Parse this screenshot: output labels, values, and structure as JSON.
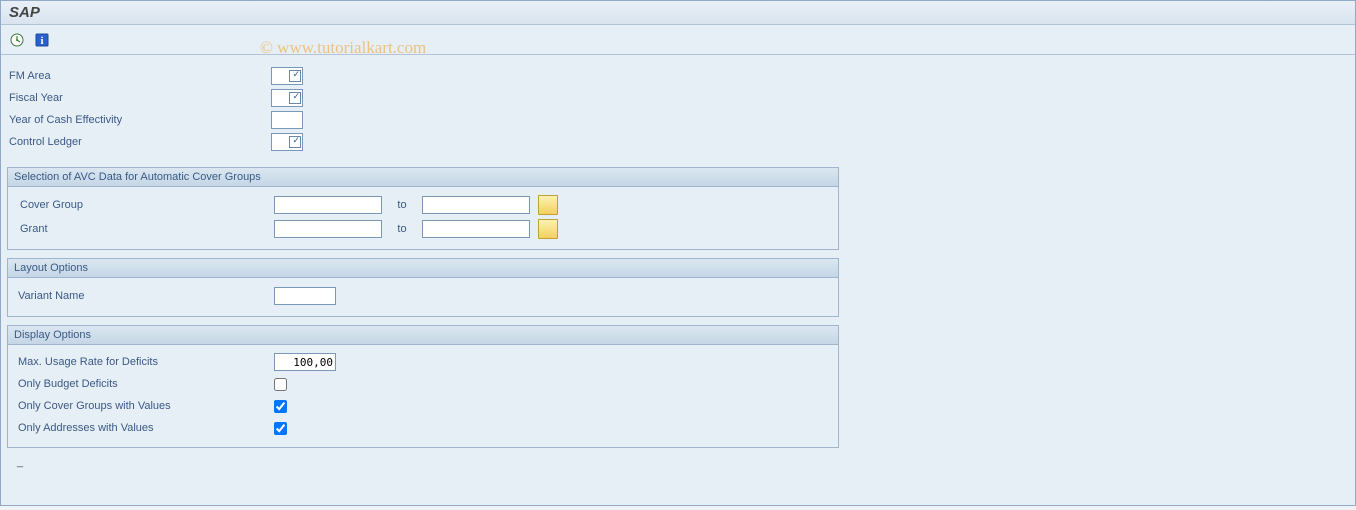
{
  "window": {
    "title": "SAP"
  },
  "watermark": "© www.tutorialkart.com",
  "topFields": {
    "fmArea": {
      "label": "FM Area",
      "value": "",
      "required": true
    },
    "fiscalYear": {
      "label": "Fiscal Year",
      "value": "",
      "required": true
    },
    "yearCash": {
      "label": "Year of Cash Effectivity",
      "value": "",
      "required": false
    },
    "controlLedger": {
      "label": "Control Ledger",
      "value": "",
      "required": true
    }
  },
  "sectionAVC": {
    "title": "Selection of AVC Data for Automatic Cover Groups",
    "coverGroup": {
      "label": "Cover Group",
      "from": "",
      "to_label": "to",
      "to": ""
    },
    "grant": {
      "label": "Grant",
      "from": "",
      "to_label": "to",
      "to": ""
    }
  },
  "sectionLayout": {
    "title": "Layout Options",
    "variantName": {
      "label": "Variant Name",
      "value": ""
    }
  },
  "sectionDisplay": {
    "title": "Display Options",
    "maxUsage": {
      "label": "Max. Usage Rate for Deficits",
      "value": "100,00"
    },
    "onlyBudget": {
      "label": "Only Budget Deficits",
      "checked": false
    },
    "onlyCoverGroups": {
      "label": "Only Cover Groups with Values",
      "checked": true
    },
    "onlyAddresses": {
      "label": "Only Addresses with Values",
      "checked": true
    }
  },
  "footer": "_"
}
